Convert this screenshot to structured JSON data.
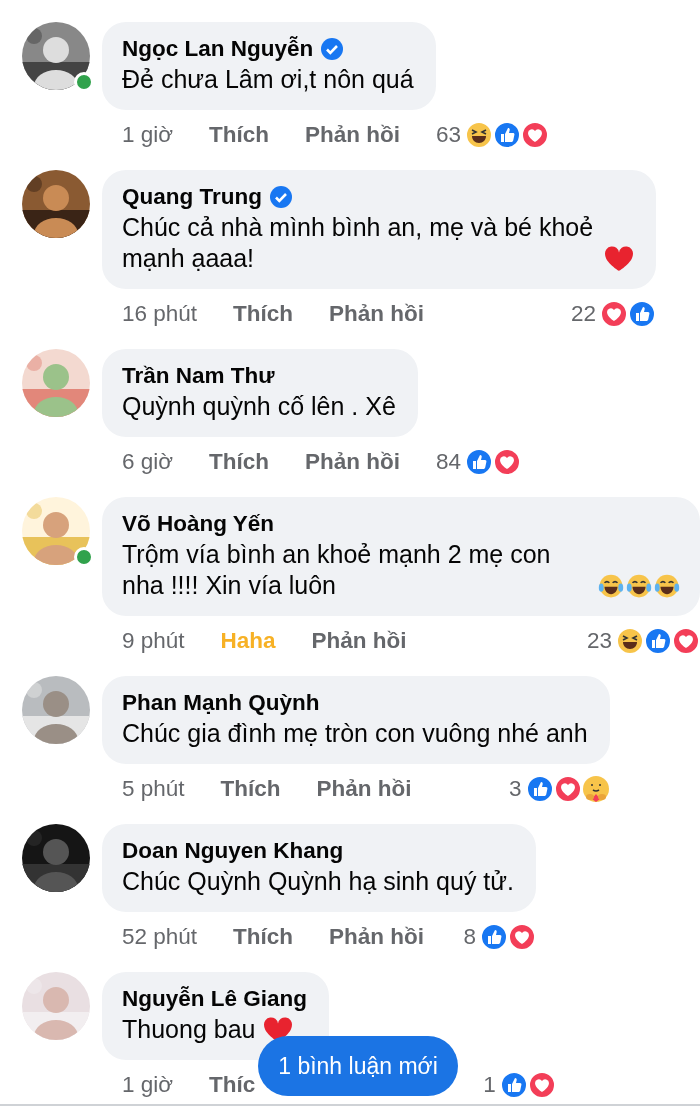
{
  "comments": [
    {
      "name": "Ngọc Lan Nguyễn",
      "verified": true,
      "online": true,
      "text": "Đẻ chưa Lâm ơi,t nôn quá",
      "time": "1 giờ",
      "like_label": "Thích",
      "reacted": false,
      "reply_label": "Phản hồi",
      "count": "63",
      "reactions": [
        {
          "kind": "haha"
        },
        {
          "kind": "like"
        },
        {
          "kind": "love"
        }
      ]
    },
    {
      "name": "Quang Trung",
      "verified": true,
      "online": false,
      "text": "Chúc cả nhà mình bình an, mẹ và bé khoẻ mạnh ạaaa!",
      "emoji": [
        {
          "kind": "heart"
        }
      ],
      "time": "16 phút",
      "like_label": "Thích",
      "reacted": false,
      "reply_label": "Phản hồi",
      "count": "22",
      "reactions": [
        {
          "kind": "love"
        },
        {
          "kind": "like"
        }
      ]
    },
    {
      "name": "Trần Nam Thư",
      "verified": false,
      "online": false,
      "text": "Quỳnh quỳnh cố lên . Xê",
      "time": "6 giờ",
      "like_label": "Thích",
      "reacted": false,
      "reply_label": "Phản hồi",
      "count": "84",
      "reactions": [
        {
          "kind": "like"
        },
        {
          "kind": "love"
        }
      ]
    },
    {
      "name": "Võ Hoàng Yến",
      "verified": false,
      "online": true,
      "text": "Trộm vía bình an khoẻ mạnh 2 mẹ con nha !!!! Xin vía luôn",
      "emoji": [
        {
          "kind": "tears"
        },
        {
          "kind": "tears"
        },
        {
          "kind": "tears"
        }
      ],
      "time": "9 phút",
      "like_label": "Haha",
      "reacted": true,
      "reply_label": "Phản hồi",
      "count": "23",
      "reactions": [
        {
          "kind": "haha"
        },
        {
          "kind": "like"
        },
        {
          "kind": "love"
        }
      ]
    },
    {
      "name": "Phan Mạnh Quỳnh",
      "verified": false,
      "online": false,
      "text": "Chúc gia đình mẹ tròn con vuông nhé anh",
      "time": "5 phút",
      "like_label": "Thích",
      "reacted": false,
      "reply_label": "Phản hồi",
      "count": "3",
      "reactions": [
        {
          "kind": "like"
        },
        {
          "kind": "love"
        },
        {
          "kind": "care"
        }
      ]
    },
    {
      "name": "Doan Nguyen Khang",
      "verified": false,
      "online": false,
      "text": "Chúc Quỳnh Quỳnh hạ sinh quý tử.",
      "time": "52 phút",
      "like_label": "Thích",
      "reacted": false,
      "reply_label": "Phản hồi",
      "count": "8",
      "reactions": [
        {
          "kind": "like"
        },
        {
          "kind": "love"
        }
      ]
    },
    {
      "name": "Nguyễn Lê Giang",
      "verified": false,
      "online": false,
      "text": "Thuong bau",
      "emoji": [
        {
          "kind": "heart"
        }
      ],
      "time": "1 giờ",
      "like_label": "Thíc",
      "reacted": false,
      "count": "1",
      "reactions": [
        {
          "kind": "like"
        },
        {
          "kind": "love"
        }
      ]
    }
  ],
  "new_comments_button": "1 bình luận mới"
}
